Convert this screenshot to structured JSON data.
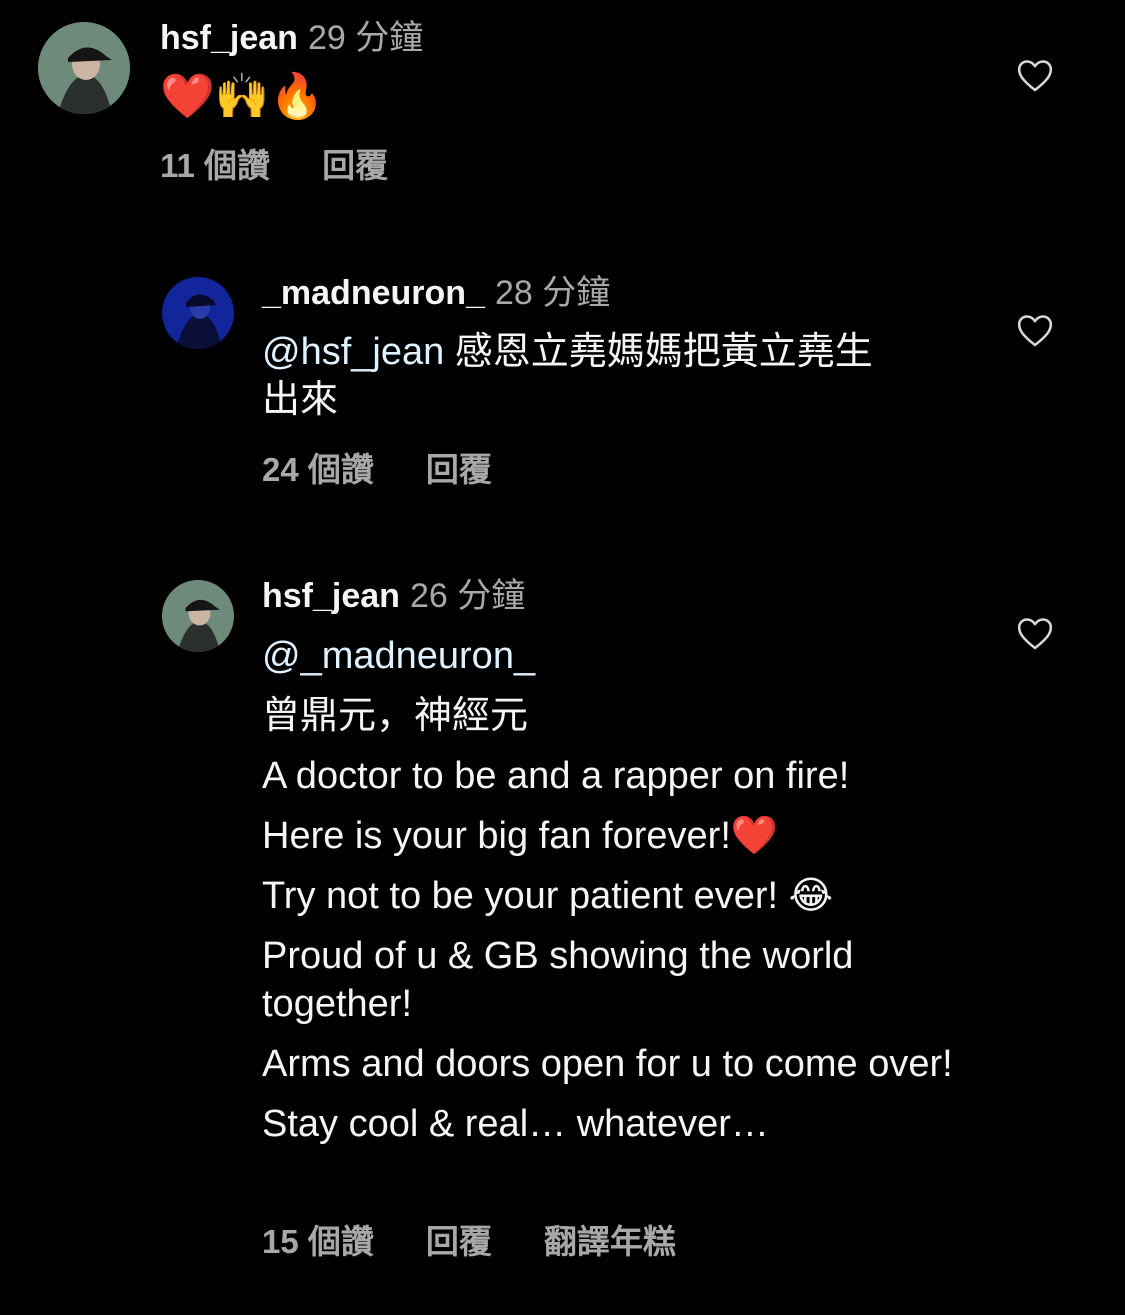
{
  "comments": [
    {
      "username": "hsf_jean",
      "time": "29 分鐘",
      "emojis": "❤️🙌🔥",
      "likes": "11 個讚",
      "reply": "回覆"
    },
    {
      "username": "_madneuron_",
      "time": "28 分鐘",
      "mention": "@hsf_jean",
      "text_line1": " 感恩立堯媽媽把黃立堯生",
      "text_line2": "出來",
      "likes": "24 個讚",
      "reply": "回覆"
    },
    {
      "username": "hsf_jean",
      "time": "26 分鐘",
      "mention": "@_madneuron_",
      "lines": [
        "曾鼎元，神經元",
        "A doctor to be and a rapper on fire!",
        "Here is your big fan forever!❤️",
        "Try not to be your patient ever! 😂",
        "Proud of u & GB showing the world together!",
        "Arms and doors open for u to come over!",
        "Stay cool & real… whatever…"
      ],
      "likes": "15 個讚",
      "reply": "回覆",
      "translate": "翻譯年糕"
    }
  ],
  "icons": {
    "like": "heart-outline-icon"
  },
  "colors": {
    "background": "#000000",
    "text": "#f5f5f5",
    "secondary": "#a8a8a8",
    "mention": "#e0f1ff"
  }
}
